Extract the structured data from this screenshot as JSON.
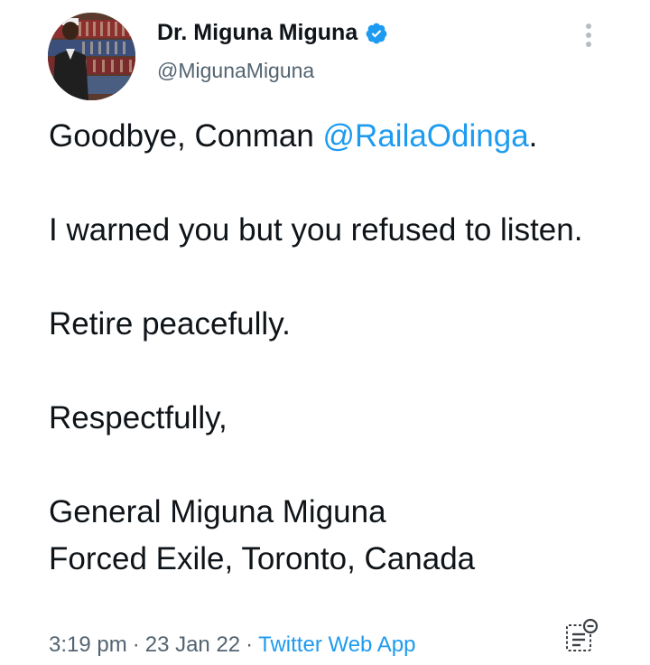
{
  "author": {
    "name": "Dr. Miguna Miguna",
    "handle": "@MigunaMiguna",
    "verified": true,
    "verified_icon": "verified-badge-icon",
    "avatar_icon": "profile-avatar"
  },
  "menu": {
    "icon": "more-vertical-icon"
  },
  "tweet": {
    "line1_prefix": "Goodbye, Conman ",
    "mention": "@RailaOdinga",
    "line1_suffix": ".",
    "para2": "I warned you but you refused to listen.",
    "para3": "Retire peacefully.",
    "para4": "Respectfully,",
    "sign1": "General Miguna Miguna",
    "sign2": "Forced Exile, Toronto, Canada"
  },
  "meta": {
    "time": "3:19 pm",
    "separator": "·",
    "date": "23 Jan 22",
    "source": "Twitter Web App"
  },
  "analytics": {
    "icon": "tweet-analytics-icon"
  },
  "colors": {
    "text": "#0f1419",
    "secondary": "#536471",
    "link": "#1d9bf0",
    "background": "#ffffff"
  }
}
